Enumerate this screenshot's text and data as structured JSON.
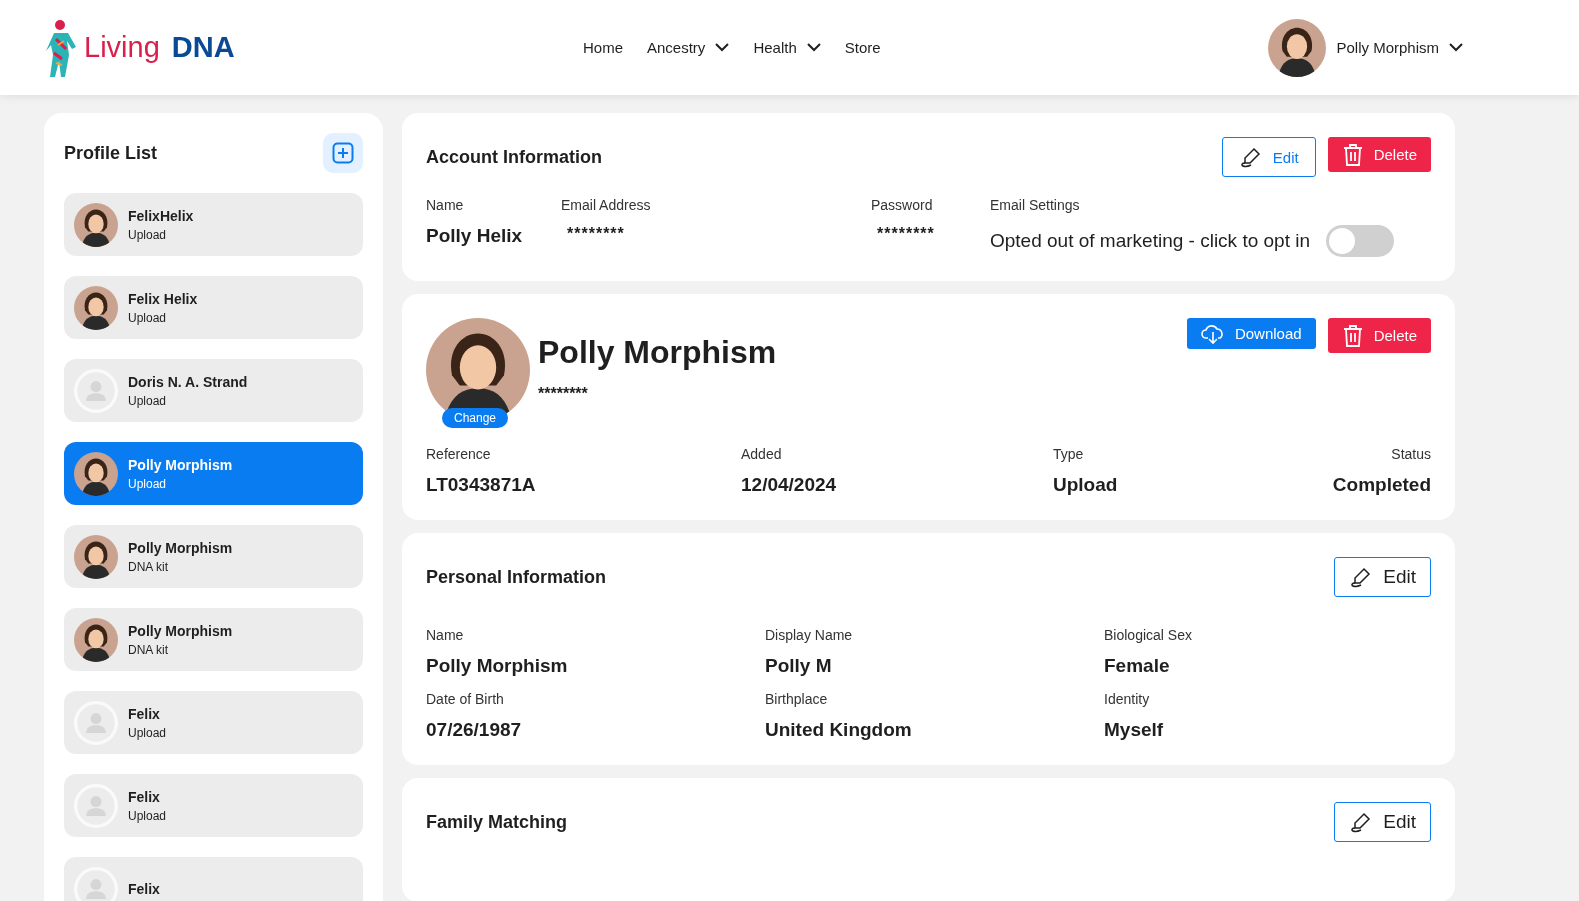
{
  "header": {
    "logo": {
      "light": "Living",
      "bold": "DNA"
    },
    "nav": [
      {
        "label": "Home",
        "dropdown": false
      },
      {
        "label": "Ancestry",
        "dropdown": true
      },
      {
        "label": "Health",
        "dropdown": true
      },
      {
        "label": "Store",
        "dropdown": false
      }
    ],
    "user": {
      "name": "Polly Morphism"
    }
  },
  "sidebar": {
    "title": "Profile List",
    "items": [
      {
        "kind": "photo",
        "name": "FelixHelix",
        "subtitle": "Upload",
        "selected": false
      },
      {
        "kind": "photo",
        "name": "Felix Helix",
        "subtitle": "Upload",
        "selected": false
      },
      {
        "kind": "placeholder",
        "name": "Doris N. A. Strand",
        "subtitle": "Upload",
        "selected": false
      },
      {
        "kind": "photo",
        "name": "Polly Morphism",
        "subtitle": "Upload",
        "selected": true
      },
      {
        "kind": "photo",
        "name": "Polly Morphism",
        "subtitle": "DNA kit",
        "selected": false
      },
      {
        "kind": "photo",
        "name": "Polly Morphism",
        "subtitle": "DNA kit",
        "selected": false
      },
      {
        "kind": "placeholder",
        "name": "Felix",
        "subtitle": "Upload",
        "selected": false
      },
      {
        "kind": "placeholder",
        "name": "Felix",
        "subtitle": "Upload",
        "selected": false
      },
      {
        "kind": "placeholder",
        "name": "Felix",
        "selected": false
      }
    ]
  },
  "account": {
    "title": "Account Information",
    "edit": "Edit",
    "delete": "Delete",
    "fields": [
      {
        "label": "Name",
        "value": "Polly Helix"
      },
      {
        "label": "Email Address",
        "value": "********"
      },
      {
        "label": "Password",
        "value": "********"
      }
    ],
    "email_settings": {
      "label": "Email Settings",
      "value": "Opted out of marketing - click to opt in",
      "on": false
    }
  },
  "profile": {
    "name": "Polly Morphism",
    "masked": "********",
    "change": "Change",
    "download": "Download",
    "delete": "Delete",
    "fields": [
      {
        "label": "Reference",
        "value": "LT0343871A"
      },
      {
        "label": "Added",
        "value": "12/04/2024"
      },
      {
        "label": "Type",
        "value": "Upload"
      },
      {
        "label": "Status",
        "value": "Completed"
      }
    ]
  },
  "personal": {
    "title": "Personal Information",
    "edit": "Edit",
    "fields": [
      {
        "label": "Name",
        "value": "Polly Morphism"
      },
      {
        "label": "Display Name",
        "value": "Polly M"
      },
      {
        "label": "Biological Sex",
        "value": "Female"
      },
      {
        "label": "Date of Birth",
        "value": "07/26/1987"
      },
      {
        "label": "Birthplace",
        "value": "United Kingdom"
      },
      {
        "label": "Identity",
        "value": "Myself"
      }
    ]
  },
  "family": {
    "title": "Family Matching",
    "edit": "Edit"
  }
}
